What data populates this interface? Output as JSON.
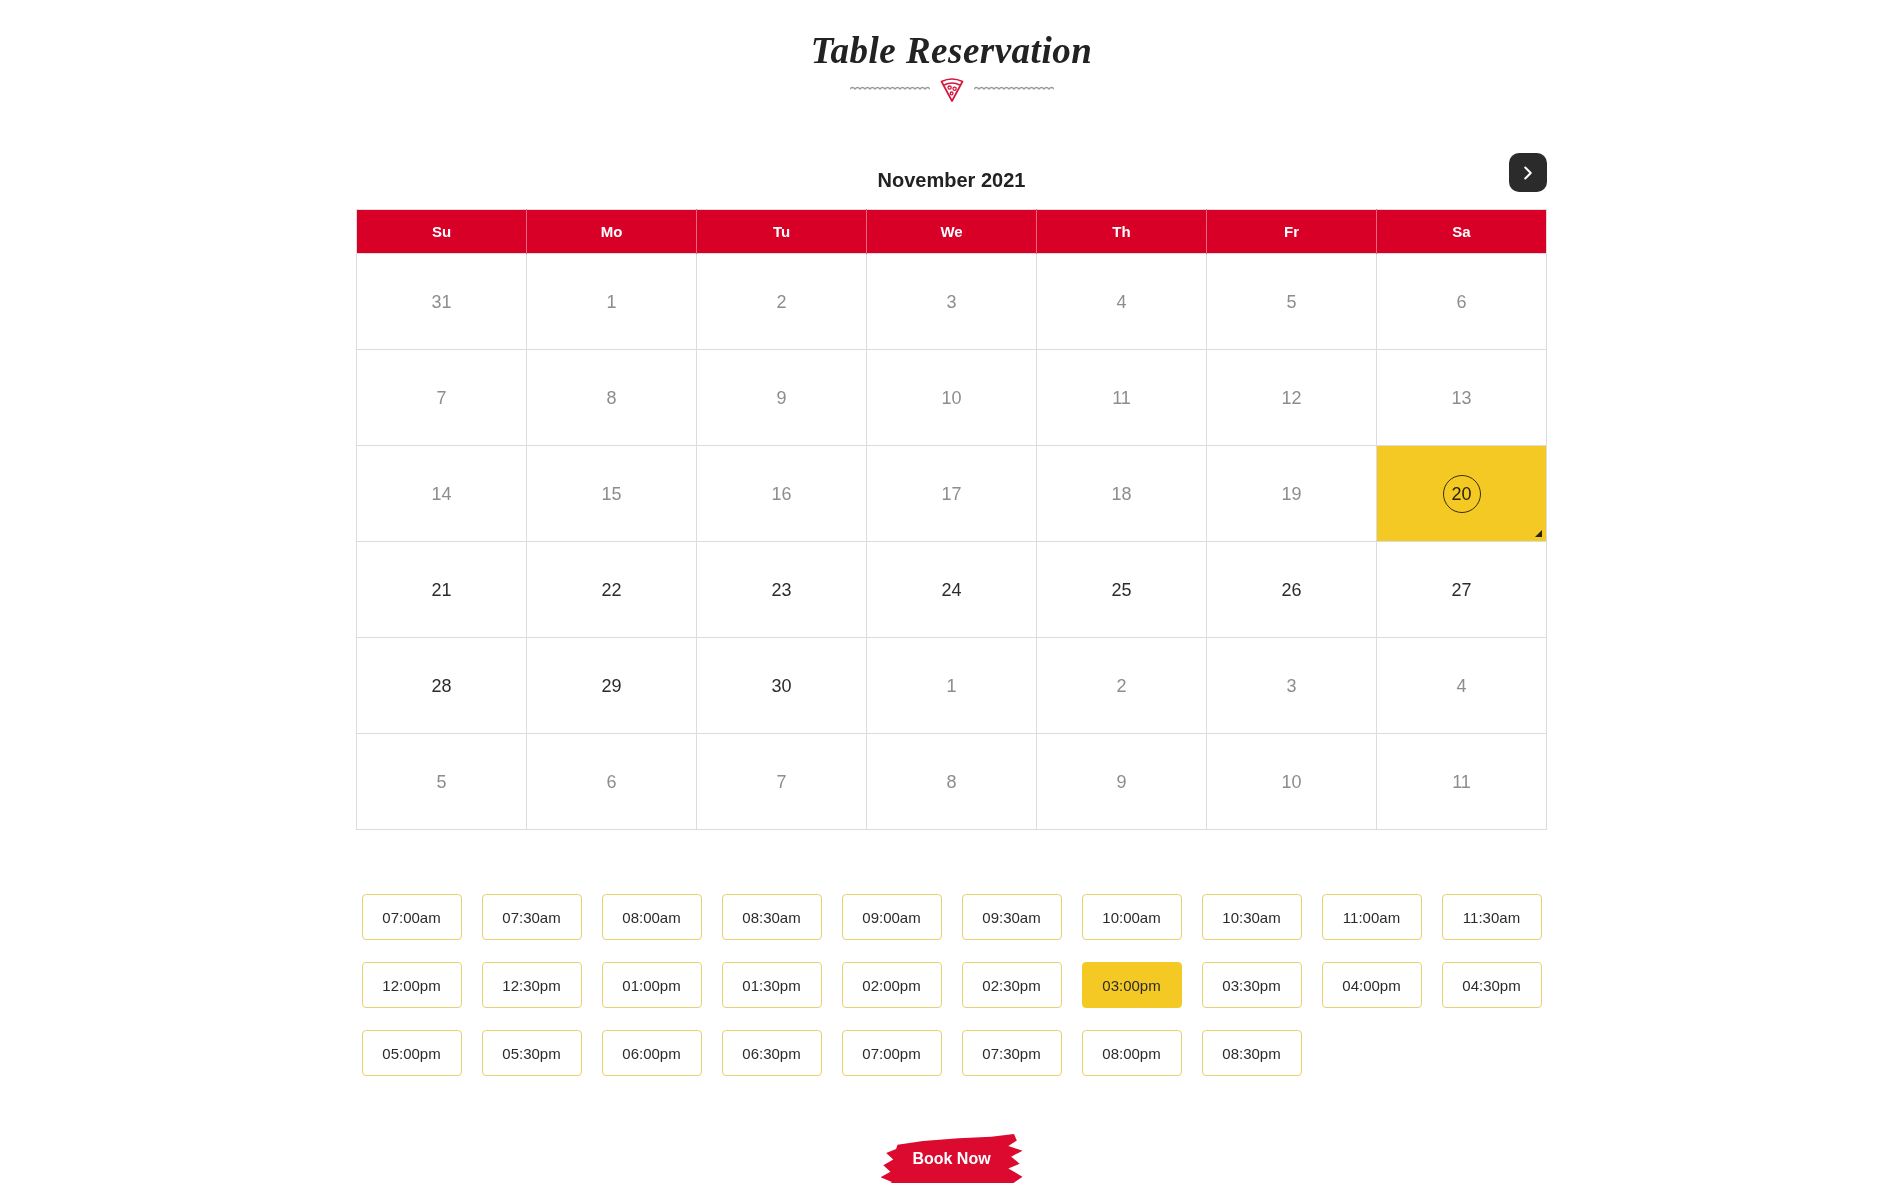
{
  "title": "Table Reservation",
  "calendar": {
    "month": "November 2021",
    "weekdays": [
      "Su",
      "Mo",
      "Tu",
      "We",
      "Th",
      "Fr",
      "Sa"
    ],
    "weeks": [
      {
        "days": [
          {
            "day": "31",
            "available": false,
            "selected": false
          },
          {
            "day": "1",
            "available": false,
            "selected": false
          },
          {
            "day": "2",
            "available": false,
            "selected": false
          },
          {
            "day": "3",
            "available": false,
            "selected": false
          },
          {
            "day": "4",
            "available": false,
            "selected": false
          },
          {
            "day": "5",
            "available": false,
            "selected": false
          },
          {
            "day": "6",
            "available": false,
            "selected": false
          }
        ]
      },
      {
        "days": [
          {
            "day": "7",
            "available": false,
            "selected": false
          },
          {
            "day": "8",
            "available": false,
            "selected": false
          },
          {
            "day": "9",
            "available": false,
            "selected": false
          },
          {
            "day": "10",
            "available": false,
            "selected": false
          },
          {
            "day": "11",
            "available": false,
            "selected": false
          },
          {
            "day": "12",
            "available": false,
            "selected": false
          },
          {
            "day": "13",
            "available": false,
            "selected": false
          }
        ]
      },
      {
        "days": [
          {
            "day": "14",
            "available": false,
            "selected": false
          },
          {
            "day": "15",
            "available": false,
            "selected": false
          },
          {
            "day": "16",
            "available": false,
            "selected": false
          },
          {
            "day": "17",
            "available": false,
            "selected": false
          },
          {
            "day": "18",
            "available": false,
            "selected": false
          },
          {
            "day": "19",
            "available": false,
            "selected": false
          },
          {
            "day": "20",
            "available": true,
            "selected": true
          }
        ]
      },
      {
        "days": [
          {
            "day": "21",
            "available": true,
            "selected": false
          },
          {
            "day": "22",
            "available": true,
            "selected": false
          },
          {
            "day": "23",
            "available": true,
            "selected": false
          },
          {
            "day": "24",
            "available": true,
            "selected": false
          },
          {
            "day": "25",
            "available": true,
            "selected": false
          },
          {
            "day": "26",
            "available": true,
            "selected": false
          },
          {
            "day": "27",
            "available": true,
            "selected": false
          }
        ]
      },
      {
        "days": [
          {
            "day": "28",
            "available": true,
            "selected": false
          },
          {
            "day": "29",
            "available": true,
            "selected": false
          },
          {
            "day": "30",
            "available": true,
            "selected": false
          },
          {
            "day": "1",
            "available": false,
            "selected": false
          },
          {
            "day": "2",
            "available": false,
            "selected": false
          },
          {
            "day": "3",
            "available": false,
            "selected": false
          },
          {
            "day": "4",
            "available": false,
            "selected": false
          }
        ]
      },
      {
        "days": [
          {
            "day": "5",
            "available": false,
            "selected": false
          },
          {
            "day": "6",
            "available": false,
            "selected": false
          },
          {
            "day": "7",
            "available": false,
            "selected": false
          },
          {
            "day": "8",
            "available": false,
            "selected": false
          },
          {
            "day": "9",
            "available": false,
            "selected": false
          },
          {
            "day": "10",
            "available": false,
            "selected": false
          },
          {
            "day": "11",
            "available": false,
            "selected": false
          }
        ]
      }
    ]
  },
  "time_slots": [
    {
      "label": "07:00am",
      "selected": false
    },
    {
      "label": "07:30am",
      "selected": false
    },
    {
      "label": "08:00am",
      "selected": false
    },
    {
      "label": "08:30am",
      "selected": false
    },
    {
      "label": "09:00am",
      "selected": false
    },
    {
      "label": "09:30am",
      "selected": false
    },
    {
      "label": "10:00am",
      "selected": false
    },
    {
      "label": "10:30am",
      "selected": false
    },
    {
      "label": "11:00am",
      "selected": false
    },
    {
      "label": "11:30am",
      "selected": false
    },
    {
      "label": "12:00pm",
      "selected": false
    },
    {
      "label": "12:30pm",
      "selected": false
    },
    {
      "label": "01:00pm",
      "selected": false
    },
    {
      "label": "01:30pm",
      "selected": false
    },
    {
      "label": "02:00pm",
      "selected": false
    },
    {
      "label": "02:30pm",
      "selected": false
    },
    {
      "label": "03:00pm",
      "selected": true
    },
    {
      "label": "03:30pm",
      "selected": false
    },
    {
      "label": "04:00pm",
      "selected": false
    },
    {
      "label": "04:30pm",
      "selected": false
    },
    {
      "label": "05:00pm",
      "selected": false
    },
    {
      "label": "05:30pm",
      "selected": false
    },
    {
      "label": "06:00pm",
      "selected": false
    },
    {
      "label": "06:30pm",
      "selected": false
    },
    {
      "label": "07:00pm",
      "selected": false
    },
    {
      "label": "07:30pm",
      "selected": false
    },
    {
      "label": "08:00pm",
      "selected": false
    },
    {
      "label": "08:30pm",
      "selected": false
    }
  ],
  "book_button": "Book Now"
}
